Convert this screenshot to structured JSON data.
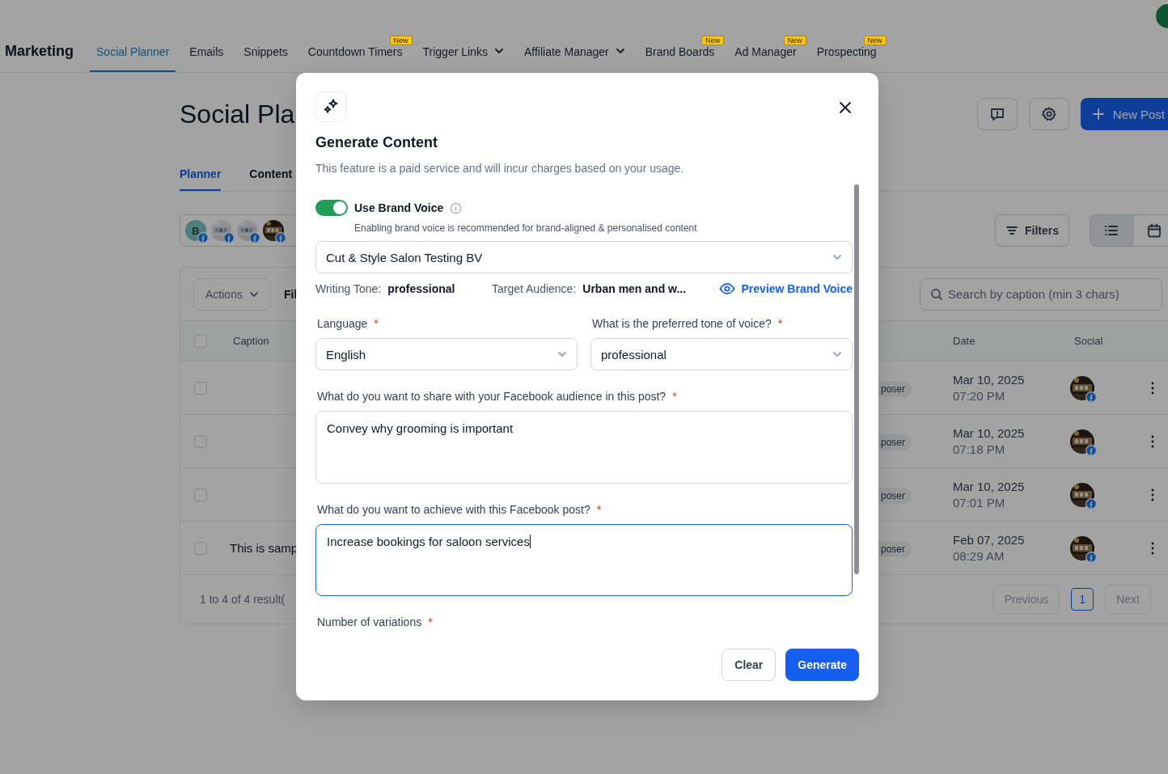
{
  "nav": {
    "title": "Marketing",
    "items": [
      {
        "label": "Social Planner",
        "selected": true,
        "dropdown": false
      },
      {
        "label": "Emails",
        "selected": false,
        "dropdown": false
      },
      {
        "label": "Snippets",
        "selected": false,
        "dropdown": false
      },
      {
        "label": "Countdown Timers",
        "selected": false,
        "dropdown": false,
        "badge": "New"
      },
      {
        "label": "Trigger Links",
        "selected": false,
        "dropdown": true
      },
      {
        "label": "Affiliate Manager",
        "selected": false,
        "dropdown": true
      },
      {
        "label": "Brand Boards",
        "selected": false,
        "dropdown": false,
        "badge": "New"
      },
      {
        "label": "Ad Manager",
        "selected": false,
        "dropdown": false,
        "badge": "New"
      },
      {
        "label": "Prospecting",
        "selected": false,
        "dropdown": false,
        "badge": "New"
      }
    ]
  },
  "page": {
    "title": "Social Pla",
    "new_post_button": "New Post",
    "tabs": [
      {
        "label": "Planner",
        "selected": true
      },
      {
        "label": "Content",
        "selected": false
      }
    ],
    "accounts": [
      {
        "kind": "letter",
        "initial": "B"
      },
      {
        "kind": "picture"
      },
      {
        "kind": "picture"
      },
      {
        "kind": "picture"
      }
    ],
    "filters_button": "Filters",
    "views": [
      {
        "kind": "list",
        "selected": true
      },
      {
        "kind": "calendar",
        "selected": false
      }
    ],
    "actions_button": "Actions",
    "filter_label": "Fil",
    "search": {
      "placeholder": "Search by caption (min 3 chars)"
    },
    "table": {
      "all_checked": false,
      "columns": [
        "Caption",
        "Date",
        "Social"
      ],
      "rows": [
        {
          "checked": false,
          "badge": "poser",
          "date": "Mar 10, 2025",
          "time": "07:20 PM"
        },
        {
          "checked": false,
          "badge": "poser",
          "date": "Mar 10, 2025",
          "time": "07:18 PM"
        },
        {
          "checked": false,
          "badge": "poser",
          "date": "Mar 10, 2025",
          "time": "07:01 PM"
        },
        {
          "checked": false,
          "caption": "This is samp",
          "badge": "poser",
          "date": "Feb 07, 2025",
          "time": "08:29 AM"
        }
      ]
    },
    "pagination": {
      "summary": "1 to 4 of 4 result(",
      "previous": "Previous",
      "pages": [
        {
          "label": "1",
          "selected": true
        }
      ],
      "next": "Next"
    }
  },
  "modal": {
    "title": "Generate Content",
    "description": "This feature is a paid service and will incur charges based on your usage.",
    "brand_voice": {
      "label": "Use Brand Voice",
      "on": true,
      "hint": "Enabling brand voice is recommended for brand-aligned & personalised content",
      "brand": "Cut & Style Salon Testing BV",
      "details": [
        {
          "label": "Writing Tone:",
          "value": "professional"
        },
        {
          "label": "Target Audience:",
          "value": "Urban men and w..."
        }
      ],
      "preview_link": "Preview Brand Voice"
    },
    "fields": [
      {
        "kind": "select",
        "label": "Language",
        "required_mark": "*",
        "value": "English"
      },
      {
        "kind": "select",
        "label": "What is the preferred tone of voice?",
        "required_mark": "*",
        "value": "professional"
      },
      {
        "kind": "textarea",
        "label": "What do you want to share with your Facebook audience in this post?",
        "required_mark": "*",
        "value": "Convey why grooming is important",
        "focused": false
      },
      {
        "kind": "textarea",
        "label": "What do you want to achieve with this Facebook post?",
        "required_mark": "*",
        "value": "Increase bookings for saloon services",
        "focused": true
      },
      {
        "kind": "number",
        "label": "Number of variations",
        "required_mark": "*"
      }
    ],
    "buttons": [
      {
        "label": "Clear",
        "kind": "secondary"
      },
      {
        "label": "Generate",
        "kind": "primary"
      }
    ]
  }
}
